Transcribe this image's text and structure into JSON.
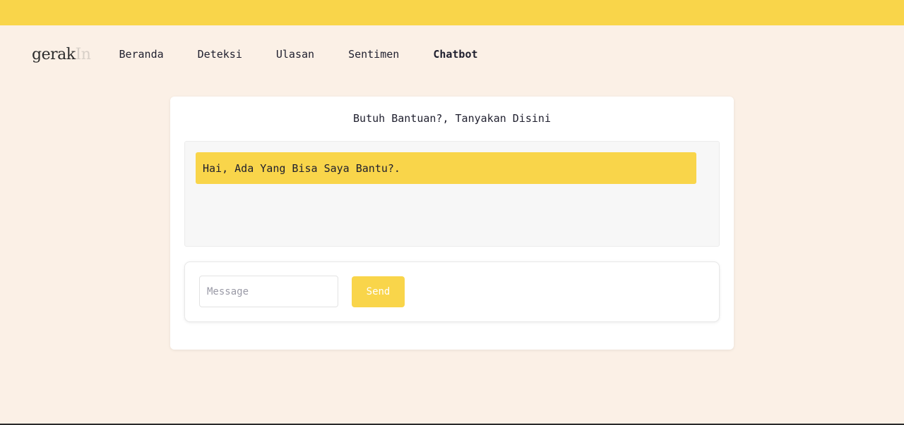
{
  "brand": {
    "logo_main": "gerak",
    "logo_suffix": "In",
    "primary_color": "#f9d54a",
    "background_color": "#fbf0e6"
  },
  "nav": {
    "items": [
      {
        "label": "Beranda",
        "active": false
      },
      {
        "label": "Deteksi",
        "active": false
      },
      {
        "label": "Ulasan",
        "active": false
      },
      {
        "label": "Sentimen",
        "active": false
      },
      {
        "label": "Chatbot",
        "active": true
      }
    ]
  },
  "chat": {
    "title": "Butuh Bantuan?, Tanyakan Disini",
    "messages": [
      {
        "sender": "bot",
        "text": "Hai, Ada Yang Bisa Saya Bantu?."
      }
    ],
    "input": {
      "value": "",
      "placeholder": "Message"
    },
    "send_label": "Send"
  }
}
